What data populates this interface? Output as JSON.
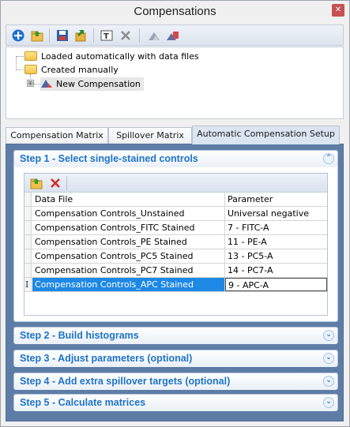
{
  "window": {
    "title": "Compensations",
    "close_glyph": "✕"
  },
  "toolbar": {
    "buttons": [
      "add-icon",
      "open-folder-icon",
      "save-icon",
      "export-icon",
      "rename-icon",
      "delete-icon",
      "apply-icon",
      "copy-icon"
    ]
  },
  "tree": {
    "nodes": [
      {
        "label": "Loaded automatically with data files"
      },
      {
        "label": "Created manually"
      },
      {
        "label": "New Compensation"
      }
    ],
    "expander": "⊞"
  },
  "tabs": [
    {
      "label": "Compensation Matrix"
    },
    {
      "label": "Spillover Matrix"
    },
    {
      "label": "Automatic Compensation Setup",
      "active": true
    }
  ],
  "steps": [
    {
      "title": "Step 1 - Select single-stained controls",
      "expanded": true
    },
    {
      "title": "Step 2 - Build histograms"
    },
    {
      "title": "Step 3 - Adjust parameters (optional)"
    },
    {
      "title": "Step 4 - Add extra spillover targets (optional)"
    },
    {
      "title": "Step 5 - Calculate matrices"
    }
  ],
  "chevrons": {
    "up": "⌃",
    "down": "⌄"
  },
  "grid": {
    "headers": [
      "Data File",
      "Parameter"
    ],
    "rows": [
      {
        "file": "Compensation Controls_Unstained",
        "param": "Universal negative"
      },
      {
        "file": "Compensation Controls_FITC Stained",
        "param": "7 - FITC-A"
      },
      {
        "file": "Compensation Controls_PE Stained",
        "param": "11 - PE-A"
      },
      {
        "file": "Compensation Controls_PC5 Stained",
        "param": "13 - PC5-A"
      },
      {
        "file": "Compensation Controls_PC7 Stained",
        "param": "14 - PC7-A"
      },
      {
        "file": "Compensation Controls_APC Stained",
        "param": "9 - APC-A",
        "selected": true
      }
    ],
    "cursor_glyph": "I"
  },
  "colors": {
    "accent": "#1e73c7",
    "panel": "#5d7da6",
    "selection": "#1e88e5"
  }
}
